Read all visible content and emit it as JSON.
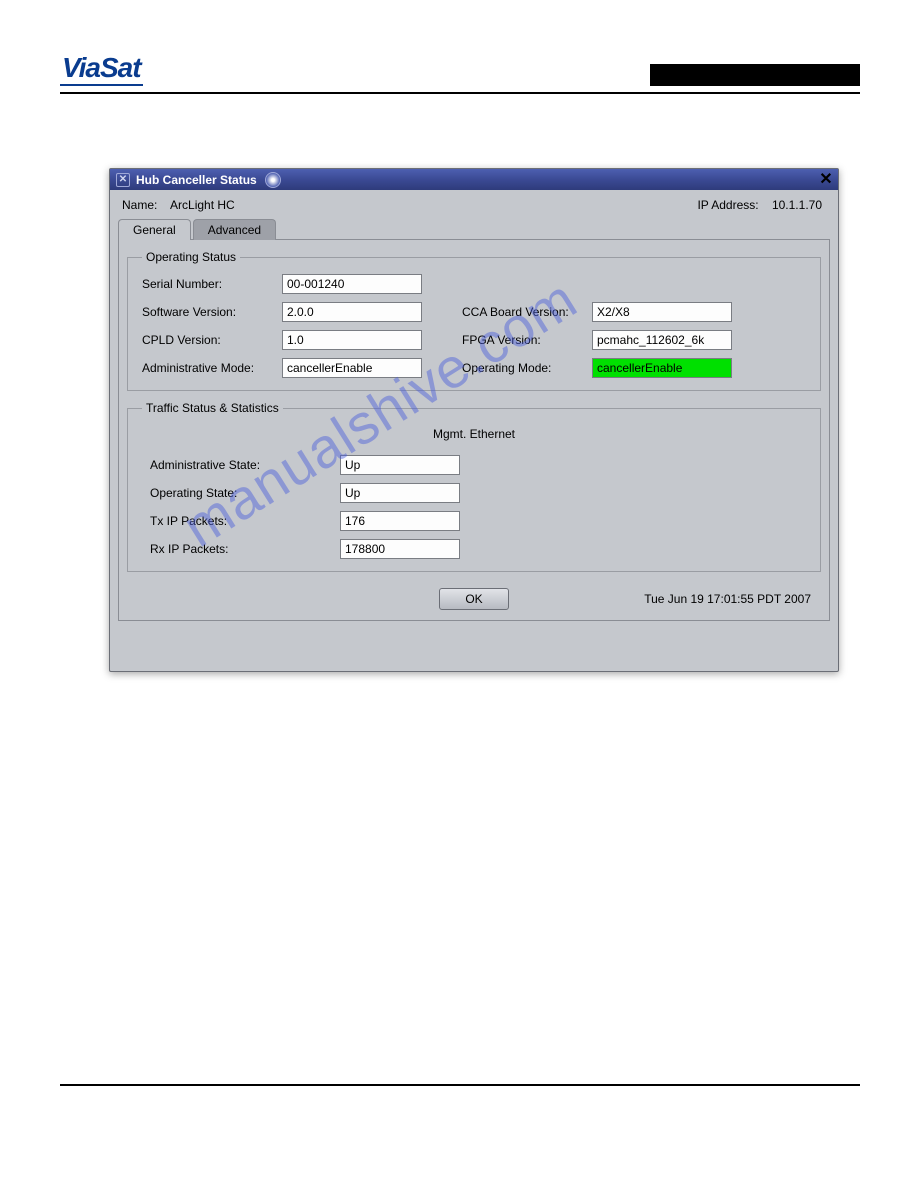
{
  "header": {
    "logo_text": "ViaSat"
  },
  "dialog": {
    "title": "Hub Canceller Status",
    "name_label": "Name:",
    "name_value": "ArcLight HC",
    "ip_label": "IP Address:",
    "ip_value": "10.1.1.70",
    "tabs": {
      "general": "General",
      "advanced": "Advanced"
    },
    "operating_status": {
      "legend": "Operating Status",
      "serial_label": "Serial Number:",
      "serial_value": "00-001240",
      "software_label": "Software Version:",
      "software_value": "2.0.0",
      "cca_label": "CCA Board Version:",
      "cca_value": "X2/X8",
      "cpld_label": "CPLD Version:",
      "cpld_value": "1.0",
      "fpga_label": "FPGA Version:",
      "fpga_value": "pcmahc_112602_6k",
      "admin_label": "Administrative Mode:",
      "admin_value": "cancellerEnable",
      "oper_label": "Operating Mode:",
      "oper_value": "cancellerEnable"
    },
    "traffic": {
      "legend": "Traffic Status & Statistics",
      "subtitle": "Mgmt. Ethernet",
      "admin_state_label": "Administrative State:",
      "admin_state_value": "Up",
      "oper_state_label": "Operating State:",
      "oper_state_value": "Up",
      "tx_label": "Tx IP Packets:",
      "tx_value": "176",
      "rx_label": "Rx IP Packets:",
      "rx_value": "178800"
    },
    "ok_label": "OK",
    "timestamp": "Tue Jun 19 17:01:55 PDT 2007"
  },
  "watermark": "manualshive.com"
}
